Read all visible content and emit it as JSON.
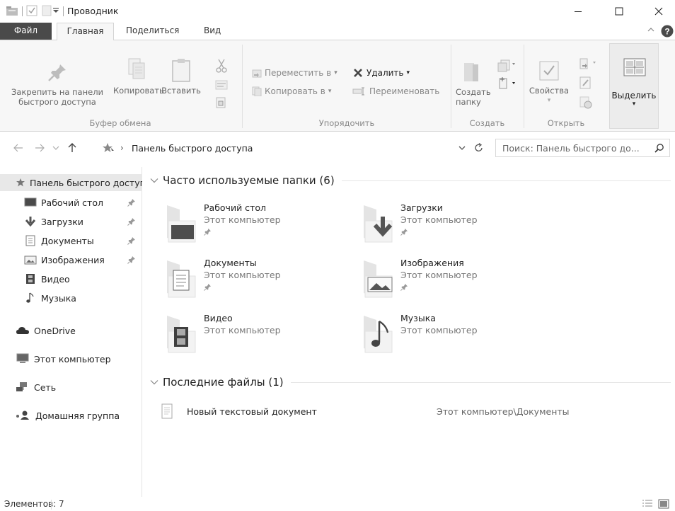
{
  "window": {
    "title": "Проводник",
    "minimize": "—",
    "maximize": "☐",
    "close": "✕"
  },
  "ribbon_tabs": {
    "file": "Файл",
    "home": "Главная",
    "share": "Поделиться",
    "view": "Вид"
  },
  "ribbon": {
    "pin_quick_access": "Закрепить на панели быстрого доступа",
    "copy": "Копировать",
    "paste": "Вставить",
    "move_to": "Переместить в",
    "copy_to": "Копировать в",
    "delete": "Удалить",
    "rename": "Переименовать",
    "new_folder": "Создать папку",
    "properties": "Свойства",
    "select": "Выделить",
    "groups": {
      "clipboard": "Буфер обмена",
      "organize": "Упорядочить",
      "new": "Создать",
      "open": "Открыть"
    }
  },
  "address": {
    "path": "Панель быстрого доступа",
    "search_placeholder": "Поиск: Панель быстрого до..."
  },
  "nav_pane": {
    "quick_access": "Панель быстрого доступа",
    "items": [
      "Рабочий стол",
      "Загрузки",
      "Документы",
      "Изображения",
      "Видео",
      "Музыка"
    ],
    "onedrive": "OneDrive",
    "this_pc": "Этот компьютер",
    "network": "Сеть",
    "homegroup": "Домашняя группа"
  },
  "frequent": {
    "header": "Часто используемые папки (6)",
    "folders": [
      {
        "name": "Рабочий стол",
        "location": "Этот компьютер",
        "pinned": true
      },
      {
        "name": "Загрузки",
        "location": "Этот компьютер",
        "pinned": true
      },
      {
        "name": "Документы",
        "location": "Этот компьютер",
        "pinned": true
      },
      {
        "name": "Изображения",
        "location": "Этот компьютер",
        "pinned": true
      },
      {
        "name": "Видео",
        "location": "Этот компьютер",
        "pinned": false
      },
      {
        "name": "Музыка",
        "location": "Этот компьютер",
        "pinned": false
      }
    ]
  },
  "recent": {
    "header": "Последние файлы (1)",
    "files": [
      {
        "name": "Новый текстовый документ",
        "path": "Этот компьютер\\Документы"
      }
    ]
  },
  "status": {
    "items": "Элементов: 7"
  }
}
